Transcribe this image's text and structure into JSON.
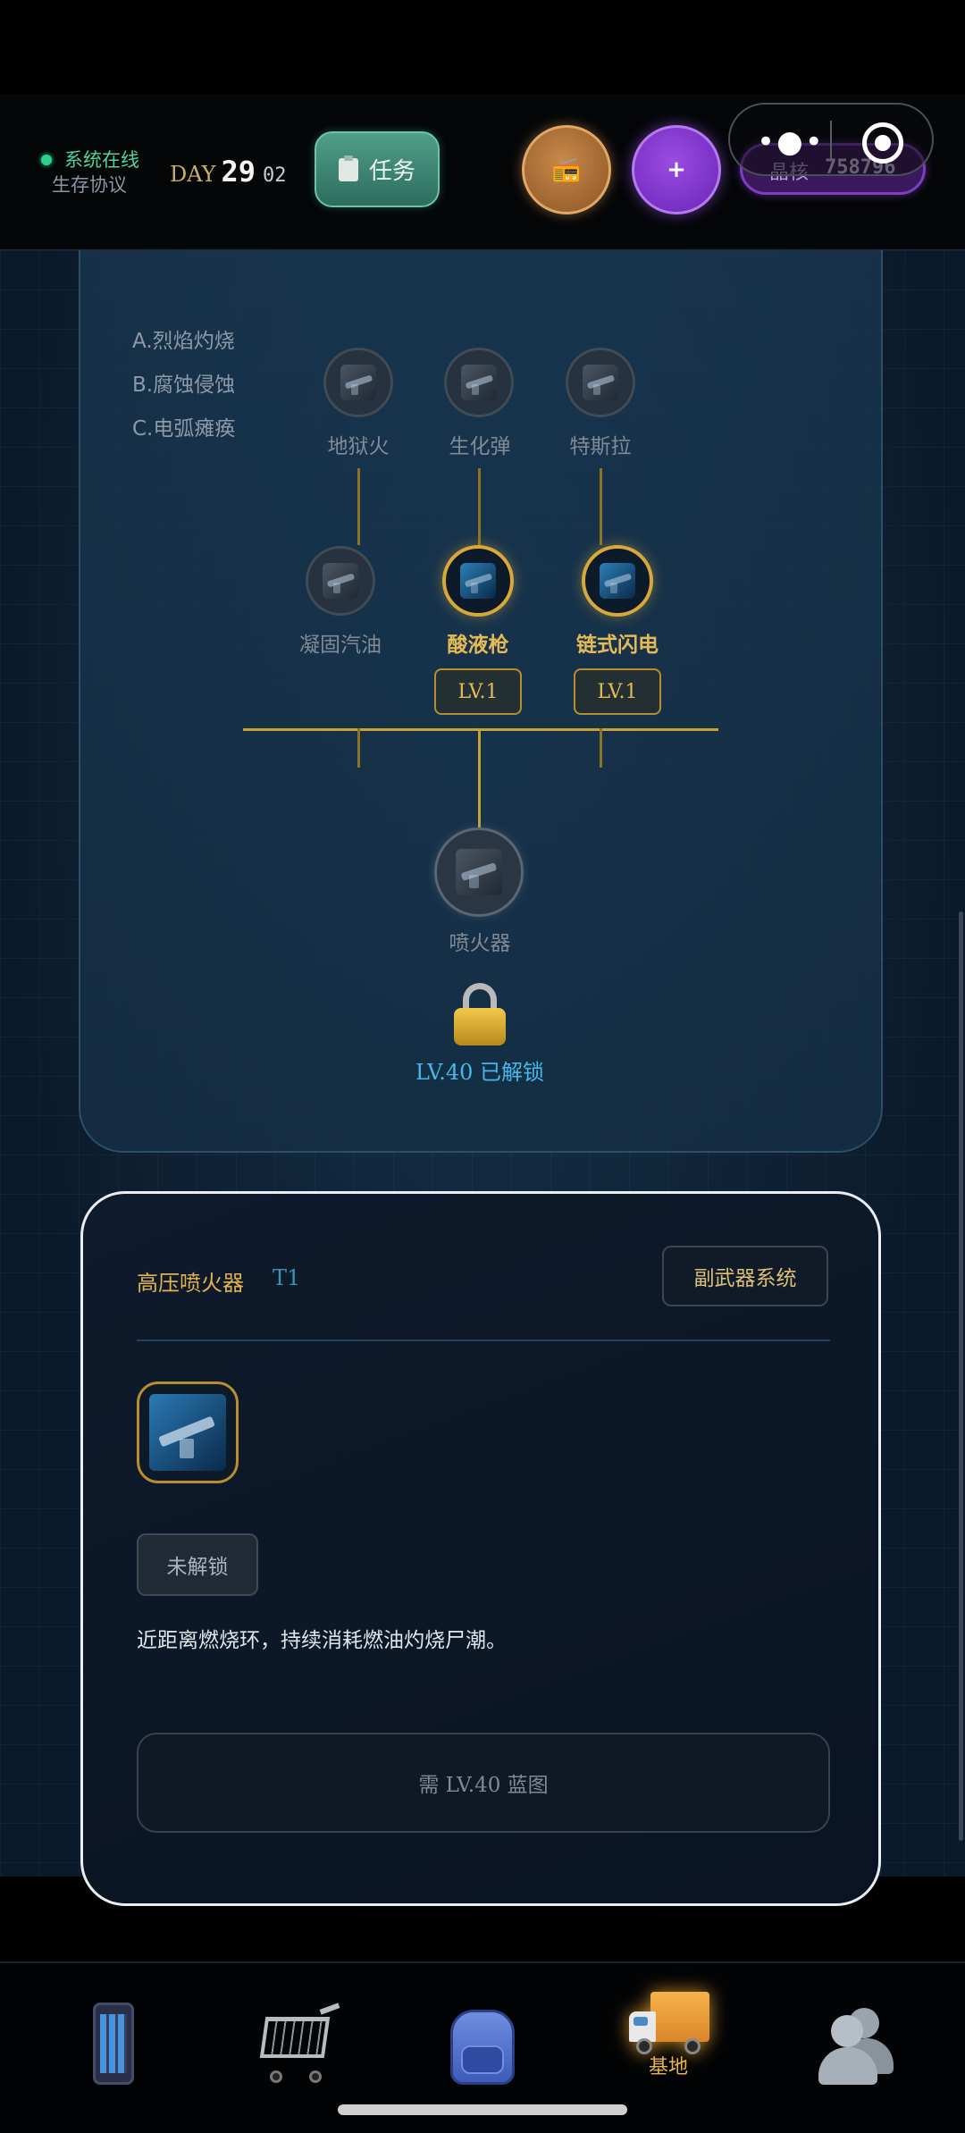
{
  "header": {
    "status_text": "系统在线",
    "app_title": "生存协议",
    "day_label": "DAY",
    "day_number": "29",
    "day_sub": "02",
    "task_button": "任务",
    "radio_icon": "radio-icon",
    "plus_symbol": "+",
    "crystal_label": "晶核",
    "crystal_value": "758796"
  },
  "tree": {
    "legend": [
      "A.烈焰灼烧",
      "B.腐蚀侵蚀",
      "C.电弧瘫痪"
    ],
    "tier2": [
      {
        "label": "地狱火",
        "unlocked": false
      },
      {
        "label": "生化弹",
        "unlocked": false
      },
      {
        "label": "特斯拉",
        "unlocked": false
      }
    ],
    "tier1": [
      {
        "label": "凝固汽油",
        "unlocked": false
      },
      {
        "label": "酸液枪",
        "unlocked": true,
        "level": "LV.1"
      },
      {
        "label": "链式闪电",
        "unlocked": true,
        "level": "LV.1"
      }
    ],
    "root": {
      "label": "喷火器"
    },
    "unlock_text": "LV.40 已解锁"
  },
  "detail": {
    "title": "高压喷火器",
    "tier": "T1",
    "system_button": "副武器系统",
    "status": "未解锁",
    "description": "近距离燃烧环，持续消耗燃油灼烧尸潮。",
    "requirement_button": "需 LV.40 蓝图"
  },
  "nav": {
    "items": [
      {
        "icon": "phone-icon",
        "label": ""
      },
      {
        "icon": "cart-icon",
        "label": ""
      },
      {
        "icon": "backpack-icon",
        "label": ""
      },
      {
        "icon": "truck-icon",
        "label": "基地",
        "active": true
      },
      {
        "icon": "users-icon",
        "label": ""
      }
    ]
  },
  "colors": {
    "accent_gold": "#e6bb55",
    "online_green": "#2bd38a",
    "unlock_blue": "#46b8e8",
    "purple": "#7b3fc0"
  }
}
